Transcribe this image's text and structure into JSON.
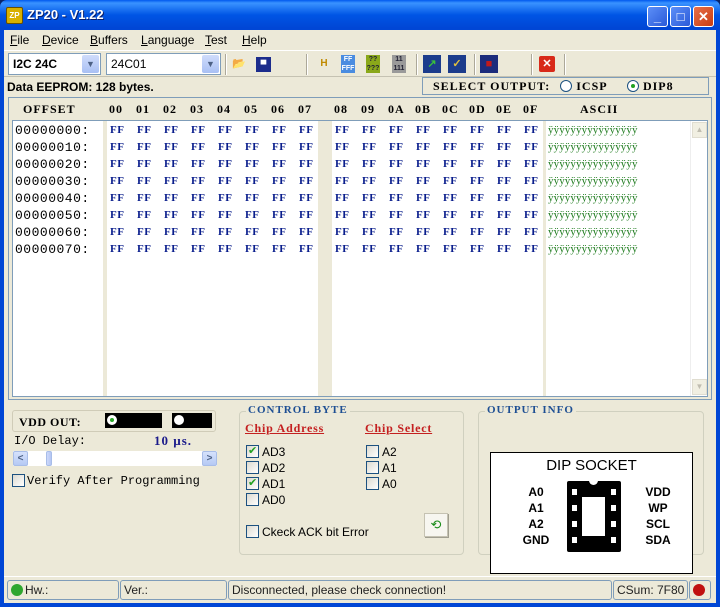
{
  "window": {
    "title": "ZP20 - V1.22",
    "app_icon": "ZP",
    "controls": {
      "minimize": "_",
      "maximize": "□",
      "close": "✕"
    }
  },
  "menu": [
    {
      "label": "File",
      "accel": "F",
      "rest": "ile"
    },
    {
      "label": "Device",
      "accel": "D",
      "rest": "evice"
    },
    {
      "label": "Buffers",
      "accel": "B",
      "rest": "uffers"
    },
    {
      "label": "Language",
      "accel": "L",
      "rest": "anguage"
    },
    {
      "label": "Test",
      "accel": "T",
      "rest": "est"
    },
    {
      "label": "Help",
      "accel": "H",
      "rest": "elp"
    }
  ],
  "toolbar": {
    "protocol_select": "I2C 24C",
    "device_select": "24C01",
    "icons": [
      "open-folder-icon",
      "save-disk-icon",
      "swap-hl-icon",
      "fill-ff-icon",
      "fill-random-icon",
      "fill-11-icon",
      "write-chip-icon",
      "verify-chip-icon",
      "erase-chip-icon",
      "close-red-x-icon"
    ]
  },
  "info": {
    "eeprom_label": "Data EEPROM: 128 bytes."
  },
  "select_output": {
    "label": "SELECT OUTPUT:",
    "options": [
      {
        "label": "ICSP",
        "selected": false
      },
      {
        "label": "DIP8",
        "selected": true
      }
    ]
  },
  "hex": {
    "offset_header": "OFFSET",
    "columns_low": [
      "00",
      "01",
      "02",
      "03",
      "04",
      "05",
      "06",
      "07"
    ],
    "columns_high": [
      "08",
      "09",
      "0A",
      "0B",
      "0C",
      "0D",
      "0E",
      "0F"
    ],
    "ascii_header": "ASCII",
    "rows": [
      {
        "offset": "00000000:",
        "bytes": [
          "FF",
          "FF",
          "FF",
          "FF",
          "FF",
          "FF",
          "FF",
          "FF",
          "FF",
          "FF",
          "FF",
          "FF",
          "FF",
          "FF",
          "FF",
          "FF"
        ],
        "ascii": "ÿÿÿÿÿÿÿÿÿÿÿÿÿÿÿÿ"
      },
      {
        "offset": "00000010:",
        "bytes": [
          "FF",
          "FF",
          "FF",
          "FF",
          "FF",
          "FF",
          "FF",
          "FF",
          "FF",
          "FF",
          "FF",
          "FF",
          "FF",
          "FF",
          "FF",
          "FF"
        ],
        "ascii": "ÿÿÿÿÿÿÿÿÿÿÿÿÿÿÿÿ"
      },
      {
        "offset": "00000020:",
        "bytes": [
          "FF",
          "FF",
          "FF",
          "FF",
          "FF",
          "FF",
          "FF",
          "FF",
          "FF",
          "FF",
          "FF",
          "FF",
          "FF",
          "FF",
          "FF",
          "FF"
        ],
        "ascii": "ÿÿÿÿÿÿÿÿÿÿÿÿÿÿÿÿ"
      },
      {
        "offset": "00000030:",
        "bytes": [
          "FF",
          "FF",
          "FF",
          "FF",
          "FF",
          "FF",
          "FF",
          "FF",
          "FF",
          "FF",
          "FF",
          "FF",
          "FF",
          "FF",
          "FF",
          "FF"
        ],
        "ascii": "ÿÿÿÿÿÿÿÿÿÿÿÿÿÿÿÿ"
      },
      {
        "offset": "00000040:",
        "bytes": [
          "FF",
          "FF",
          "FF",
          "FF",
          "FF",
          "FF",
          "FF",
          "FF",
          "FF",
          "FF",
          "FF",
          "FF",
          "FF",
          "FF",
          "FF",
          "FF"
        ],
        "ascii": "ÿÿÿÿÿÿÿÿÿÿÿÿÿÿÿÿ"
      },
      {
        "offset": "00000050:",
        "bytes": [
          "FF",
          "FF",
          "FF",
          "FF",
          "FF",
          "FF",
          "FF",
          "FF",
          "FF",
          "FF",
          "FF",
          "FF",
          "FF",
          "FF",
          "FF",
          "FF"
        ],
        "ascii": "ÿÿÿÿÿÿÿÿÿÿÿÿÿÿÿÿ"
      },
      {
        "offset": "00000060:",
        "bytes": [
          "FF",
          "FF",
          "FF",
          "FF",
          "FF",
          "FF",
          "FF",
          "FF",
          "FF",
          "FF",
          "FF",
          "FF",
          "FF",
          "FF",
          "FF",
          "FF"
        ],
        "ascii": "ÿÿÿÿÿÿÿÿÿÿÿÿÿÿÿÿ"
      },
      {
        "offset": "00000070:",
        "bytes": [
          "FF",
          "FF",
          "FF",
          "FF",
          "FF",
          "FF",
          "FF",
          "FF",
          "FF",
          "FF",
          "FF",
          "FF",
          "FF",
          "FF",
          "FF",
          "FF"
        ],
        "ascii": "ÿÿÿÿÿÿÿÿÿÿÿÿÿÿÿÿ"
      }
    ]
  },
  "left_panel": {
    "vdd_label": "VDD OUT:",
    "vdd_options": [
      {
        "selected": true
      },
      {
        "selected": false
      }
    ],
    "io_delay_label": "I/O Delay:",
    "io_delay_value": "10 µs.",
    "io_delay_slider_fraction": 0.1,
    "verify_label": "Verify After Programming",
    "verify_checked": false
  },
  "control_byte": {
    "title": "CONTROL BYTE",
    "chip_address_header": "Chip Address",
    "chip_select_header": "Chip Select",
    "address_bits": [
      {
        "label": "AD3",
        "checked": true
      },
      {
        "label": "AD2",
        "checked": false
      },
      {
        "label": "AD1",
        "checked": true
      },
      {
        "label": "AD0",
        "checked": false
      }
    ],
    "select_bits": [
      {
        "label": "A2",
        "checked": false
      },
      {
        "label": "A1",
        "checked": false
      },
      {
        "label": "A0",
        "checked": false
      }
    ],
    "ack_label": "Ckeck ACK bit Error",
    "ack_checked": false
  },
  "output_info": {
    "title": "OUTPUT INFO",
    "socket_title": "DIP SOCKET",
    "left_pins": [
      "A0",
      "A1",
      "A2",
      "GND"
    ],
    "right_pins": [
      "VDD",
      "WP",
      "SCL",
      "SDA"
    ]
  },
  "status": {
    "hw": "Hw.:",
    "ver": "Ver.:",
    "message": "Disconnected, please check connection!",
    "checksum": "CSum: 7F80",
    "hw_led_color": "#2ea62e",
    "conn_led_color": "#c01010"
  }
}
